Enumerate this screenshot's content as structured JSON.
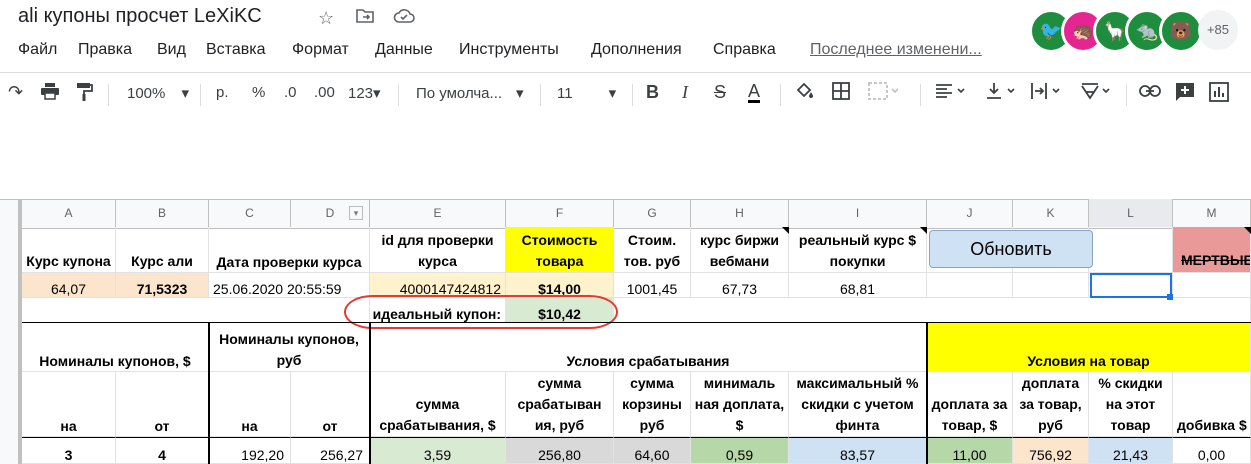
{
  "doc": {
    "title": "ali купоны просчет LeXiKC",
    "star_icon": "star-icon",
    "move_icon": "folder-move-icon",
    "cloud_icon": "cloud-status-icon"
  },
  "menu": [
    "Файл",
    "Правка",
    "Вид",
    "Вставка",
    "Формат",
    "Данные",
    "Инструменты",
    "Дополнения",
    "Справка"
  ],
  "last_edit": "Последнее изменени...",
  "collaborators": {
    "more": "+85",
    "colors": [
      "#1e8e3e",
      "#e52592",
      "#1e8e3e",
      "#1e8e3e",
      "#1e8e3e"
    ]
  },
  "toolbar": {
    "zoom": "100%",
    "currency": "р.",
    "percent": "%",
    "dec_less": ".0",
    "dec_more": ".00",
    "format_more": "123",
    "font": "По умолча...",
    "font_size": "11"
  },
  "columns": [
    "A",
    "B",
    "C",
    "D",
    "E",
    "F",
    "G",
    "H",
    "I",
    "J",
    "K",
    "L",
    "M"
  ],
  "header_row": {
    "a": "Курс купона",
    "b": "Курс али",
    "c": "Дата проверки курса",
    "e": "id для проверки курса",
    "f": "Стоимость товара",
    "g": "Стоим. тов. руб",
    "h": "курс биржи вебмани",
    "i": "реальный курс $ покупки",
    "m": "МЕРТВЫЕ"
  },
  "update_button": "Обновить",
  "value_row": {
    "a": "64,07",
    "b": "71,5323",
    "c": "25.06.2020 20:55:59",
    "e": "4000147424812",
    "f": "$14,00",
    "g": "1001,45",
    "h": "67,73",
    "i": "68,81"
  },
  "ideal": {
    "label": "идеальный купон:",
    "value": "$10,42"
  },
  "section_headers": {
    "nominals_usd": "Номиналы купонов, $",
    "nominals_rub": "Номиналы купонов, руб",
    "trigger": "Условия срабатывания",
    "goods": "Условия на товар"
  },
  "sub_headers": {
    "a": "на",
    "b": "от",
    "c": "на",
    "d": "от",
    "e": "сумма срабатывания, $",
    "f": "сумма срабатыван ия, руб",
    "g": "сумма корзины руб",
    "h": "минималь ная доплата, $",
    "i": "максимальный % скидки с учетом финта",
    "j": "доплата за товар, $",
    "k": "доплата за товар, руб",
    "l": "% скидки на этот товар",
    "m": "добивка $"
  },
  "data_row": {
    "a": "3",
    "b": "4",
    "c": "192,20",
    "d": "256,27",
    "e": "3,59",
    "f": "256,80",
    "g": "64,60",
    "h": "0,59",
    "i": "83,57",
    "j": "11,00",
    "k": "756,92",
    "l": "21,43",
    "m": "0,00"
  }
}
